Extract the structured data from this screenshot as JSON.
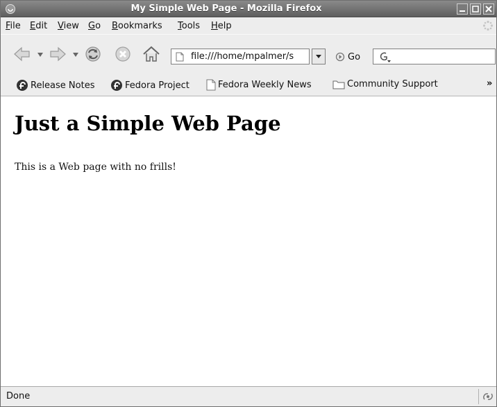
{
  "window": {
    "title": "My Simple Web Page - Mozilla Firefox"
  },
  "menubar": {
    "items": [
      {
        "accel": "F",
        "rest": "ile"
      },
      {
        "accel": "E",
        "rest": "dit"
      },
      {
        "accel": "V",
        "rest": "iew"
      },
      {
        "accel": "G",
        "rest": "o"
      },
      {
        "accel": "B",
        "rest": "ookmarks"
      },
      {
        "accel": "T",
        "rest": "ools"
      },
      {
        "accel": "H",
        "rest": "elp"
      }
    ]
  },
  "navbar": {
    "url": "file:///home/mpalmer/s",
    "go_label": "Go",
    "search_value": ""
  },
  "bookmarks": {
    "items": [
      {
        "label": "Release Notes",
        "icon": "fedora-icon"
      },
      {
        "label": "Fedora Project",
        "icon": "fedora-icon"
      },
      {
        "label": "Fedora Weekly News",
        "icon": "page-icon"
      },
      {
        "label": "Community Support",
        "icon": "folder-icon"
      }
    ],
    "overflow": "»"
  },
  "page": {
    "heading": "Just a Simple Web Page",
    "paragraph": "This is a Web page with no frills!"
  },
  "status": {
    "text": "Done"
  }
}
